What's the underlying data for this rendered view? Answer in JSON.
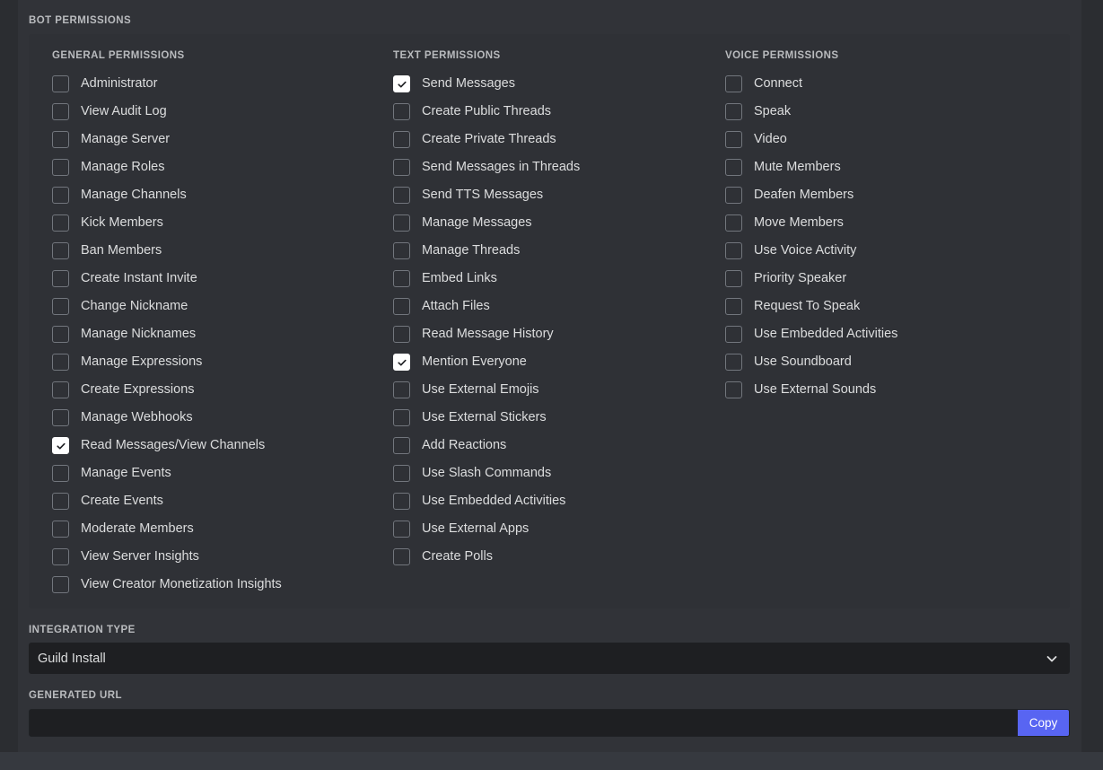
{
  "section": {
    "bot_permissions_label": "BOT PERMISSIONS",
    "integration_type_label": "INTEGRATION TYPE",
    "generated_url_label": "GENERATED URL"
  },
  "columns": [
    {
      "key": "general",
      "header": "GENERAL PERMISSIONS",
      "items": [
        {
          "label": "Administrator",
          "checked": false
        },
        {
          "label": "View Audit Log",
          "checked": false
        },
        {
          "label": "Manage Server",
          "checked": false
        },
        {
          "label": "Manage Roles",
          "checked": false
        },
        {
          "label": "Manage Channels",
          "checked": false
        },
        {
          "label": "Kick Members",
          "checked": false
        },
        {
          "label": "Ban Members",
          "checked": false
        },
        {
          "label": "Create Instant Invite",
          "checked": false
        },
        {
          "label": "Change Nickname",
          "checked": false
        },
        {
          "label": "Manage Nicknames",
          "checked": false
        },
        {
          "label": "Manage Expressions",
          "checked": false
        },
        {
          "label": "Create Expressions",
          "checked": false
        },
        {
          "label": "Manage Webhooks",
          "checked": false
        },
        {
          "label": "Read Messages/View Channels",
          "checked": true
        },
        {
          "label": "Manage Events",
          "checked": false
        },
        {
          "label": "Create Events",
          "checked": false
        },
        {
          "label": "Moderate Members",
          "checked": false
        },
        {
          "label": "View Server Insights",
          "checked": false
        },
        {
          "label": "View Creator Monetization Insights",
          "checked": false
        }
      ]
    },
    {
      "key": "text",
      "header": "TEXT PERMISSIONS",
      "items": [
        {
          "label": "Send Messages",
          "checked": true
        },
        {
          "label": "Create Public Threads",
          "checked": false
        },
        {
          "label": "Create Private Threads",
          "checked": false
        },
        {
          "label": "Send Messages in Threads",
          "checked": false
        },
        {
          "label": "Send TTS Messages",
          "checked": false
        },
        {
          "label": "Manage Messages",
          "checked": false
        },
        {
          "label": "Manage Threads",
          "checked": false
        },
        {
          "label": "Embed Links",
          "checked": false
        },
        {
          "label": "Attach Files",
          "checked": false
        },
        {
          "label": "Read Message History",
          "checked": false
        },
        {
          "label": "Mention Everyone",
          "checked": true
        },
        {
          "label": "Use External Emojis",
          "checked": false
        },
        {
          "label": "Use External Stickers",
          "checked": false
        },
        {
          "label": "Add Reactions",
          "checked": false
        },
        {
          "label": "Use Slash Commands",
          "checked": false
        },
        {
          "label": "Use Embedded Activities",
          "checked": false
        },
        {
          "label": "Use External Apps",
          "checked": false
        },
        {
          "label": "Create Polls",
          "checked": false
        }
      ]
    },
    {
      "key": "voice",
      "header": "VOICE PERMISSIONS",
      "items": [
        {
          "label": "Connect",
          "checked": false
        },
        {
          "label": "Speak",
          "checked": false
        },
        {
          "label": "Video",
          "checked": false
        },
        {
          "label": "Mute Members",
          "checked": false
        },
        {
          "label": "Deafen Members",
          "checked": false
        },
        {
          "label": "Move Members",
          "checked": false
        },
        {
          "label": "Use Voice Activity",
          "checked": false
        },
        {
          "label": "Priority Speaker",
          "checked": false
        },
        {
          "label": "Request To Speak",
          "checked": false
        },
        {
          "label": "Use Embedded Activities",
          "checked": false
        },
        {
          "label": "Use Soundboard",
          "checked": false
        },
        {
          "label": "Use External Sounds",
          "checked": false
        }
      ]
    }
  ],
  "integration_type": {
    "selected": "Guild Install",
    "chevron_icon": "chevron-down-icon"
  },
  "generated_url": {
    "value": "",
    "placeholder": "",
    "copy_label": "Copy"
  },
  "colors": {
    "accent": "#5865f2",
    "panel_bg": "#2f3136",
    "content_bg": "#313338",
    "input_bg": "#1e1f22",
    "text": "#dcddde",
    "muted_text": "#b9bbbe",
    "checkbox_border": "#72767d",
    "checked_bg": "#ffffff"
  }
}
